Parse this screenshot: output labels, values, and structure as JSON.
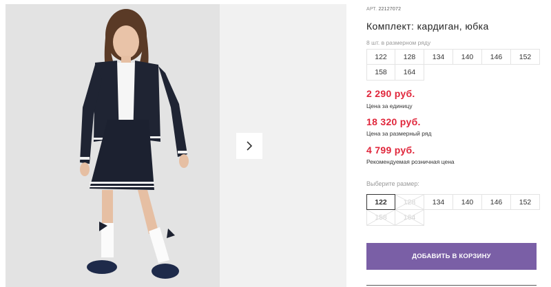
{
  "gallery": {
    "next_icon": "chevron-right-icon"
  },
  "product": {
    "article_label": "АРТ.",
    "article_number": "22127072",
    "title": "Комплект: кардиган, юбка",
    "row_label": "8 шт. в размерном ряду",
    "row_sizes": [
      "122",
      "128",
      "134",
      "140",
      "146",
      "152",
      "158",
      "164"
    ]
  },
  "prices": {
    "unit_price": "2 290 руб.",
    "unit_label": "Цена за единицу",
    "row_price": "18 320 руб.",
    "row_price_label": "Цена за размерный ряд",
    "retail_price": "4 799 руб.",
    "retail_label": "Рекомендуемая розничная цена",
    "price_color": "#e0263b"
  },
  "size_select": {
    "label": "Выберите размер:",
    "options": [
      {
        "size": "122",
        "state": "selected"
      },
      {
        "size": "128",
        "state": "unavailable"
      },
      {
        "size": "134",
        "state": "available"
      },
      {
        "size": "140",
        "state": "available"
      },
      {
        "size": "146",
        "state": "available"
      },
      {
        "size": "152",
        "state": "available"
      },
      {
        "size": "158",
        "state": "unavailable"
      },
      {
        "size": "164",
        "state": "unavailable"
      }
    ]
  },
  "cart": {
    "add_label": "ДОБАВИТЬ В КОРЗИНУ",
    "button_color": "#7a5fa6"
  }
}
